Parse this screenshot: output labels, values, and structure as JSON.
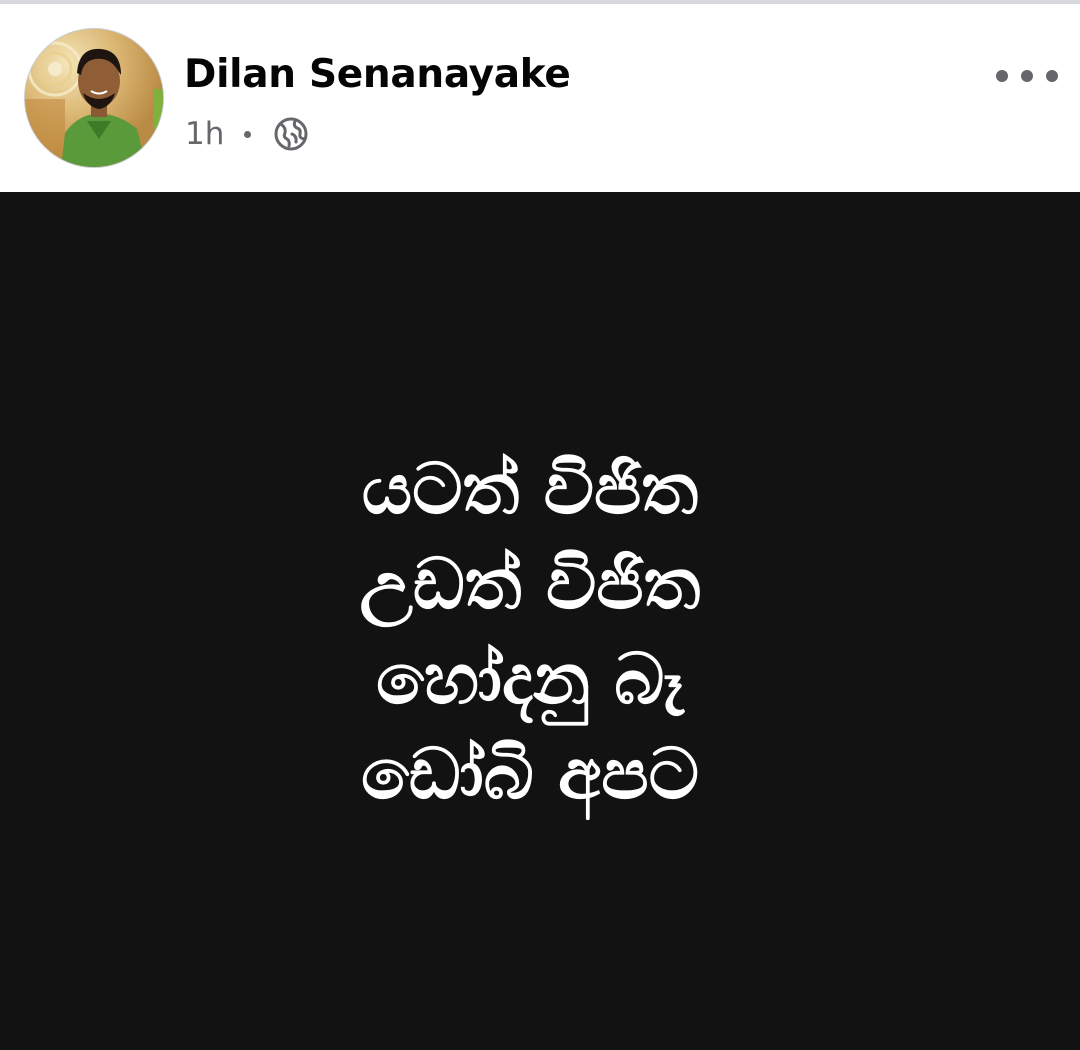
{
  "post": {
    "author": "Dilan Senanayake",
    "time": "1h",
    "privacy_icon": "globe-icon",
    "more_icon": "more-options-icon",
    "lines": [
      "යටත් විජිත",
      "උඩත් විජිත",
      "හෝදනු බෑ",
      "ඩෝබි අපට"
    ],
    "background_color": "#121212",
    "text_color": "#ffffff"
  }
}
